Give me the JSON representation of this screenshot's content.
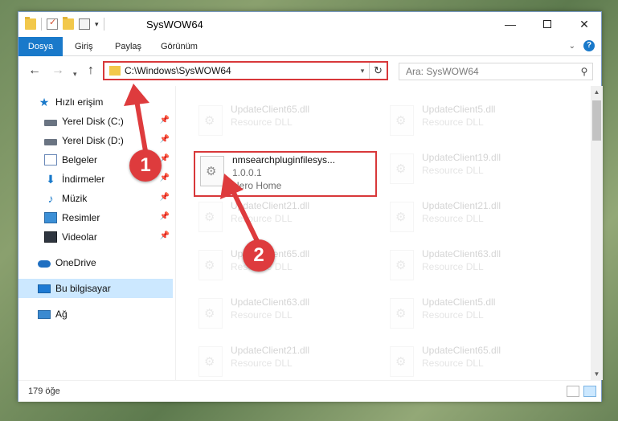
{
  "window": {
    "title": "SysWOW64"
  },
  "ribbon": {
    "tabs": [
      "Dosya",
      "Giriş",
      "Paylaş",
      "Görünüm"
    ],
    "help": "?"
  },
  "address": {
    "path": "C:\\Windows\\SysWOW64",
    "refresh": "↻"
  },
  "search": {
    "placeholder": "Ara: SysWOW64"
  },
  "sidebar": {
    "items": [
      {
        "label": "Hızlı erişim",
        "icon": "star-icon"
      },
      {
        "label": "Yerel Disk (C:)",
        "icon": "disk-icon",
        "pinned": true
      },
      {
        "label": "Yerel Disk (D:)",
        "icon": "disk-icon",
        "pinned": true
      },
      {
        "label": "Belgeler",
        "icon": "documents-icon",
        "pinned": true
      },
      {
        "label": "İndirmeler",
        "icon": "download-icon",
        "pinned": true
      },
      {
        "label": "Müzik",
        "icon": "music-icon",
        "pinned": true
      },
      {
        "label": "Resimler",
        "icon": "pictures-icon",
        "pinned": true
      },
      {
        "label": "Videolar",
        "icon": "videos-icon",
        "pinned": true
      },
      {
        "label": "OneDrive",
        "icon": "onedrive-icon"
      },
      {
        "label": "Bu bilgisayar",
        "icon": "this-pc-icon",
        "selected": true
      },
      {
        "label": "Ağ",
        "icon": "network-icon"
      }
    ]
  },
  "files": {
    "highlighted": {
      "name": "nmsearchpluginfilesys...",
      "version": "1.0.0.1",
      "company": "Nero Home"
    },
    "items": [
      {
        "name": "UpdateClient65.dll",
        "type": "Resource DLL"
      },
      {
        "name": "UpdateClient5.dll",
        "type": "Resource DLL"
      },
      {
        "name": "UpdateClient19.dll",
        "type": "Resource DLL"
      },
      {
        "name": "UpdateClient21.dll",
        "type": "Resource DLL"
      },
      {
        "name": "UpdateClient21.dll",
        "type": "Resource DLL"
      },
      {
        "name": "UpdateClient65.dll",
        "type": "Resource DLL"
      },
      {
        "name": "UpdateClient63.dll",
        "type": "Resource DLL"
      },
      {
        "name": "UpdateClient63.dll",
        "type": "Resource DLL"
      },
      {
        "name": "UpdateClient5.dll",
        "type": "Resource DLL"
      },
      {
        "name": "UpdateClient21.dll",
        "type": "Resource DLL"
      },
      {
        "name": "UpdateClient65.dll",
        "type": "Resource DLL"
      }
    ]
  },
  "status": {
    "count": "179 öğe"
  },
  "markers": {
    "one": "1",
    "two": "2"
  },
  "colors": {
    "accent": "#1979ca",
    "annotation_red": "#d8383a",
    "selection": "#cce8ff"
  }
}
